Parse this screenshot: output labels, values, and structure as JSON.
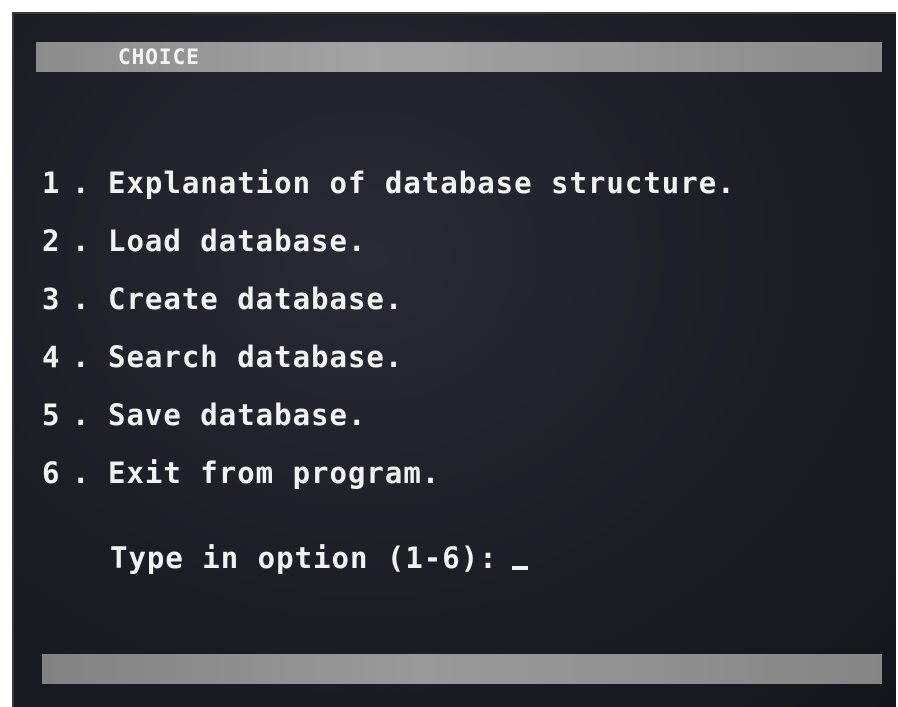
{
  "screen": {
    "title": "CHOICE",
    "menu": [
      {
        "number": "1",
        "label": "Explanation of database structure."
      },
      {
        "number": "2",
        "label": "Load database."
      },
      {
        "number": "3",
        "label": "Create database."
      },
      {
        "number": "4",
        "label": "Search database."
      },
      {
        "number": "5",
        "label": "Save database."
      },
      {
        "number": "6",
        "label": "Exit from program."
      }
    ],
    "prompt": "Type in option (1-6):",
    "colors": {
      "background": "#1d1d26",
      "text": "#f2f2f2",
      "bar": "#9a9a9a"
    }
  }
}
